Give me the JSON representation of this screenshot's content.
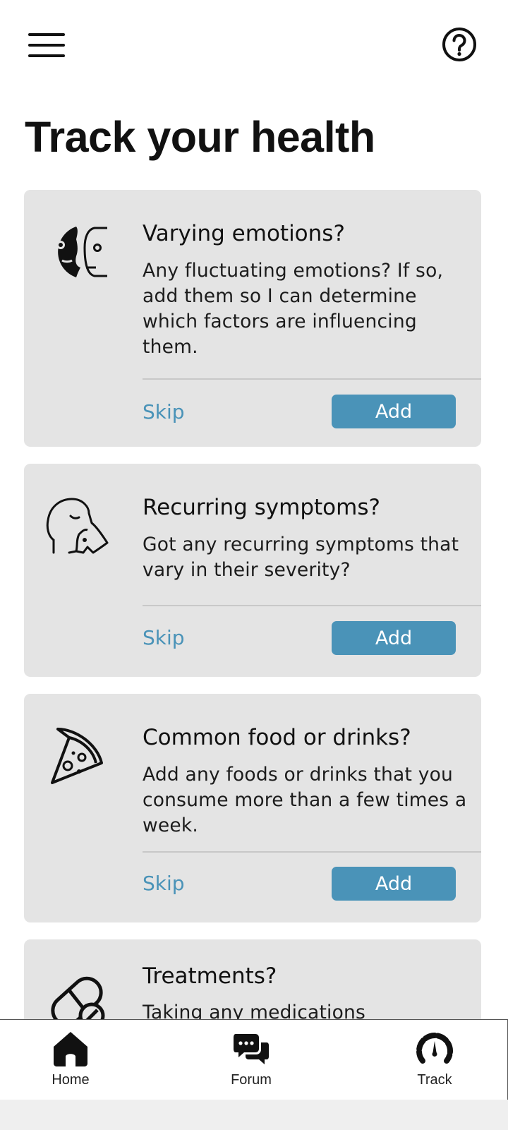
{
  "header": {
    "menu_icon": "hamburger-menu-icon",
    "help_icon": "question-circle-icon"
  },
  "page_title": "Track your health",
  "cards": [
    {
      "icon": "emotions-faces-icon",
      "title": "Varying emotions?",
      "description": "Any fluctuating emotions? If so, add them so I can determine which factors are influencing them.",
      "skip_label": "Skip",
      "add_label": "Add"
    },
    {
      "icon": "sneezing-head-icon",
      "title": "Recurring symptoms?",
      "description": "Got any recurring symptoms that vary in their severity?",
      "skip_label": "Skip",
      "add_label": "Add"
    },
    {
      "icon": "pizza-slice-icon",
      "title": "Common food or drinks?",
      "description": "Add any foods or drinks that you consume more than a few times a week.",
      "skip_label": "Skip",
      "add_label": "Add"
    },
    {
      "icon": "pill-capsule-icon",
      "title": "Treatments?",
      "description": "Taking any medications"
    }
  ],
  "bottom_nav": [
    {
      "label": "Home",
      "icon": "home-icon"
    },
    {
      "label": "Forum",
      "icon": "chat-bubbles-icon"
    },
    {
      "label": "Track",
      "icon": "gauge-icon"
    }
  ],
  "colors": {
    "accent": "#4a93b8",
    "card_background": "#e4e4e4",
    "text": "#111111"
  }
}
